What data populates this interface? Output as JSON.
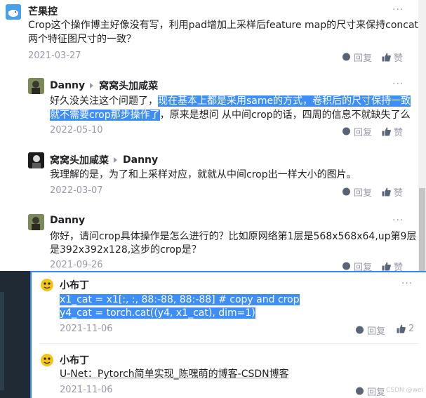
{
  "comments": [
    {
      "author": "芒果控",
      "text": "Crop这个操作博主好像没有写，利用pad增加上采样后feature map的尺寸来保持concat两个特征图尺寸的一致？",
      "line1": "Crop这个操作博主好像没有写，利用pad增加上采样后feature map的尺寸来保持concat",
      "line2": "两个特征图尺寸的一致？",
      "date": "2021-03-27",
      "reply_label": "回复",
      "like_label": "赞"
    },
    {
      "author": "Danny",
      "reply_to": "窝窝头加咸菜",
      "line1_plain": "好久没关注这个问题了，",
      "line1_hl": "现在基本上都是采用same的方式，卷积后的尺寸保持一致",
      "line2_hl": "就不需要crop那步操作了",
      "line2_plain": "，原来是想问 从中间crop的话，四周的信息不就缺失了么",
      "date": "2022-05-10",
      "reply_label": "回复",
      "like_label": "赞"
    },
    {
      "author": "窝窝头加咸菜",
      "reply_to": "Danny",
      "text": "我理解的是，为了和上采样对应，就就从中间crop出一样大小的图片。",
      "date": "2022-03-07",
      "reply_label": "回复",
      "like_label": "赞"
    },
    {
      "author": "Danny",
      "line1": "你好，请问crop具体操作是怎么进行的？比如原网络第1层是568x568x64,up第9层",
      "line2": "是392x392x128,这步的crop是？",
      "date": "2021-09-26",
      "reply_label": "回复",
      "like_label": "赞"
    }
  ],
  "overlay_comments": [
    {
      "author": "小布丁",
      "code1": "x1_cat = x1[:, :, 88:-88, 88:-88] # copy and crop",
      "code2": "y4_cat = torch.cat((y4, x1_cat), dim=1)",
      "date": "2021-11-06",
      "reply_label": "回复",
      "like_count": "2"
    },
    {
      "author": "小布丁",
      "link_text": "U-Net：Pytorch简单实现_陈嘿萌的博客-CSDN博客",
      "date": "2021-11-06",
      "reply_label": "回复"
    }
  ],
  "more_label": "···",
  "watermark": "CSDN @wei",
  "colors": {
    "highlight": "#3d8ef7",
    "meta": "#999aaa",
    "overlay_border": "#2f87f5"
  }
}
